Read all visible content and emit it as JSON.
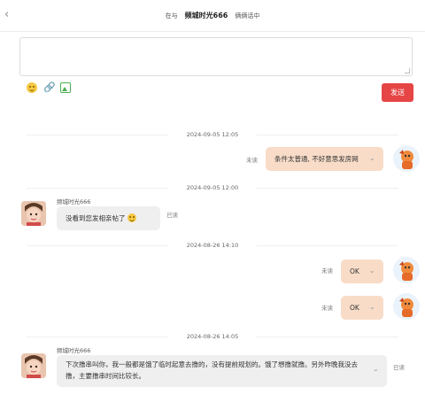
{
  "header": {
    "back_glyph": "‹",
    "prefix": "在与",
    "contact_name": "频城时光666",
    "suffix": "俩俩话中"
  },
  "composer": {
    "text": "",
    "send_label": "发送",
    "tools": [
      "emoji-icon",
      "link-icon",
      "image-icon"
    ]
  },
  "colors": {
    "send_button": "#e64545",
    "my_bubble": "#f8dcc8",
    "their_bubble": "#efefef"
  },
  "messages": [
    {
      "time": "2024-09-05 12:05",
      "from": "me",
      "text": "条件太普通, 不好意思发房网",
      "status": "未读"
    },
    {
      "time": "2024-09-05 12:00",
      "from": "peer",
      "sender": "频城时光666",
      "text": "没看到您发相亲帖了",
      "status": "已读"
    },
    {
      "time": "2024-08-26 14:10",
      "from": "me",
      "text": "OK",
      "status": "未读"
    },
    {
      "from": "me",
      "text": "OK",
      "status": "未读"
    },
    {
      "time": "2024-08-26 14:05",
      "from": "peer",
      "sender": "频城时光666",
      "text": "下次撸串叫你，我一般都是饿了临时起意去撸的，没有提前规划的。饿了想撸就撸。另外昨晚我没去撸，主要撸串时间比较长。",
      "status": "已读"
    }
  ],
  "chevron_glyph": "⌄"
}
